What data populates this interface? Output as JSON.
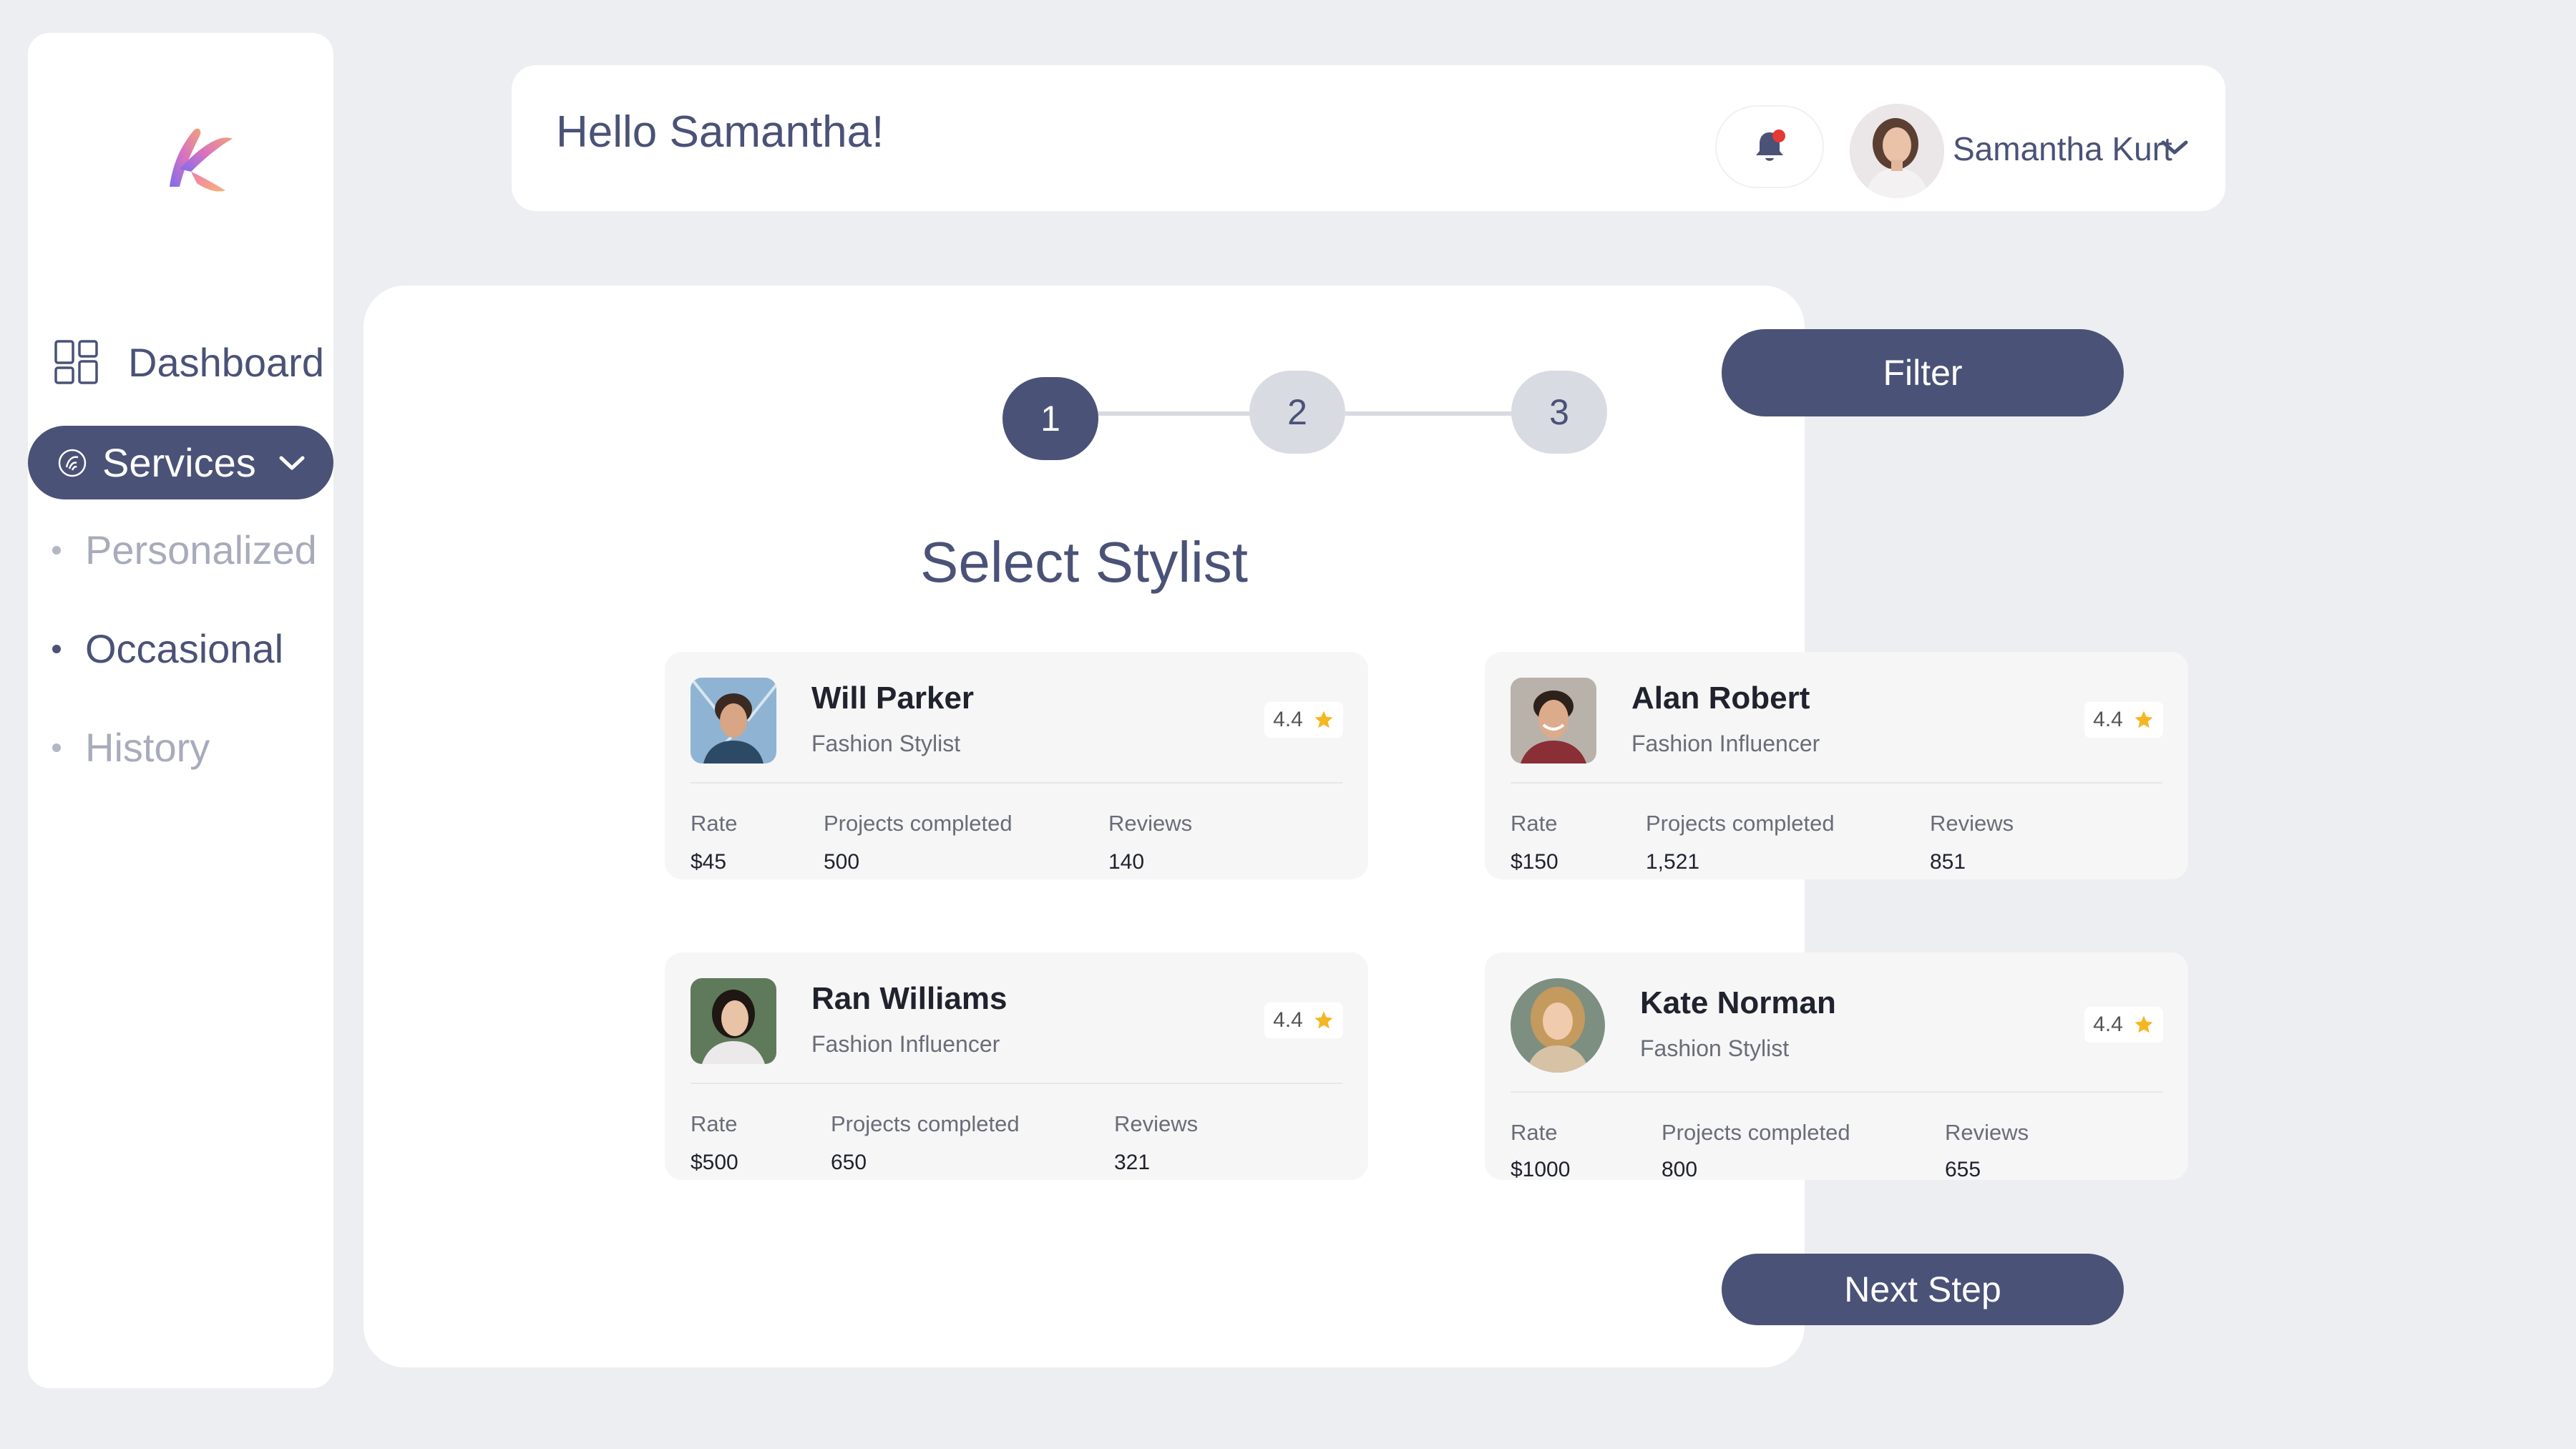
{
  "header": {
    "greeting": "Hello Samantha!",
    "user_name": "Samantha Kurt"
  },
  "sidebar": {
    "dashboard_label": "Dashboard",
    "services_label": "Services",
    "subitems": [
      {
        "label": "Personalized",
        "state": "muted"
      },
      {
        "label": "Occasional",
        "state": "active"
      },
      {
        "label": "History",
        "state": "muted"
      }
    ]
  },
  "stepper": {
    "steps": [
      "1",
      "2",
      "3"
    ],
    "current": 1
  },
  "main": {
    "title": "Select Stylist",
    "filter_label": "Filter",
    "next_label": "Next Step"
  },
  "stats_labels": {
    "rate": "Rate",
    "projects": "Projects completed",
    "reviews": "Reviews"
  },
  "stylists": [
    {
      "name": "Will Parker",
      "role": "Fashion Stylist",
      "rating": "4.4",
      "rate": "$45",
      "projects": "500",
      "reviews": "140"
    },
    {
      "name": "Alan Robert",
      "role": "Fashion Influencer",
      "rating": "4.4",
      "rate": "$150",
      "projects": "1,521",
      "reviews": "851"
    },
    {
      "name": "Ran Williams",
      "role": "Fashion Influencer",
      "rating": "4.4",
      "rate": "$500",
      "projects": "650",
      "reviews": "321"
    },
    {
      "name": "Kate Norman",
      "role": "Fashion Stylist",
      "rating": "4.4",
      "rate": "$1000",
      "projects": "800",
      "reviews": "655"
    }
  ],
  "colors": {
    "primary": "#4a5277",
    "background": "#eceef1",
    "card": "#f6f6f7",
    "star": "#f5b623",
    "notification": "#e53935"
  },
  "icons": [
    "app-logo",
    "dashboard-grid-icon",
    "services-icon",
    "chevron-down-icon",
    "bell-icon",
    "star-icon"
  ]
}
